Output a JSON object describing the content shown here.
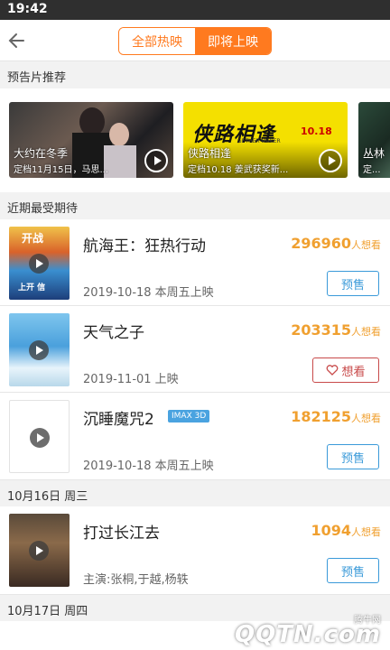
{
  "status": {
    "time": "19:42"
  },
  "header": {
    "tabs": [
      "全部热映",
      "即将上映"
    ]
  },
  "sections": {
    "trailers": "预告片推荐",
    "anticipated": "近期最受期待"
  },
  "trailers": [
    {
      "title": "大约在冬季",
      "subtitle": "定档11月15日，马思..."
    },
    {
      "title": "侠路相逢",
      "subtitle": "定档10.18 姜武获奖新..."
    },
    {
      "title": "丛林",
      "subtitle": "定..."
    }
  ],
  "trailer_art": {
    "poster_text": "侠路相逢",
    "poster_sub": "10.18",
    "poster_en": "GETHER MAKER"
  },
  "movies": [
    {
      "title": "航海王：狂热行动",
      "count": "296960",
      "count_unit": "人想看",
      "date": "2019-10-18 本周五上映",
      "button": "预售"
    },
    {
      "title": "天气之子",
      "count": "203315",
      "count_unit": "人想看",
      "date": "2019-11-01 上映",
      "button": "想看"
    },
    {
      "title": "沉睡魔咒2",
      "tag": "IMAX 3D",
      "count": "182125",
      "count_unit": "人想看",
      "date": "2019-10-18 本周五上映",
      "button": "预售"
    }
  ],
  "date_groups": [
    "10月16日 周三",
    "10月17日 周四"
  ],
  "group_movies": [
    {
      "title": "打过长江去",
      "count": "1094",
      "count_unit": "人想看",
      "date": "主演:张桐,于越,杨轶",
      "button": "预售"
    }
  ],
  "poster_texts": [
    "开战",
    "上开 信"
  ],
  "watermark": {
    "line1": "腾牛网",
    "line2": "QQTN.com"
  },
  "colors": {
    "accent": "#ff7a1f",
    "want": "#f0a030",
    "presale": "#3a9ad9",
    "wish": "#c84a4a"
  }
}
